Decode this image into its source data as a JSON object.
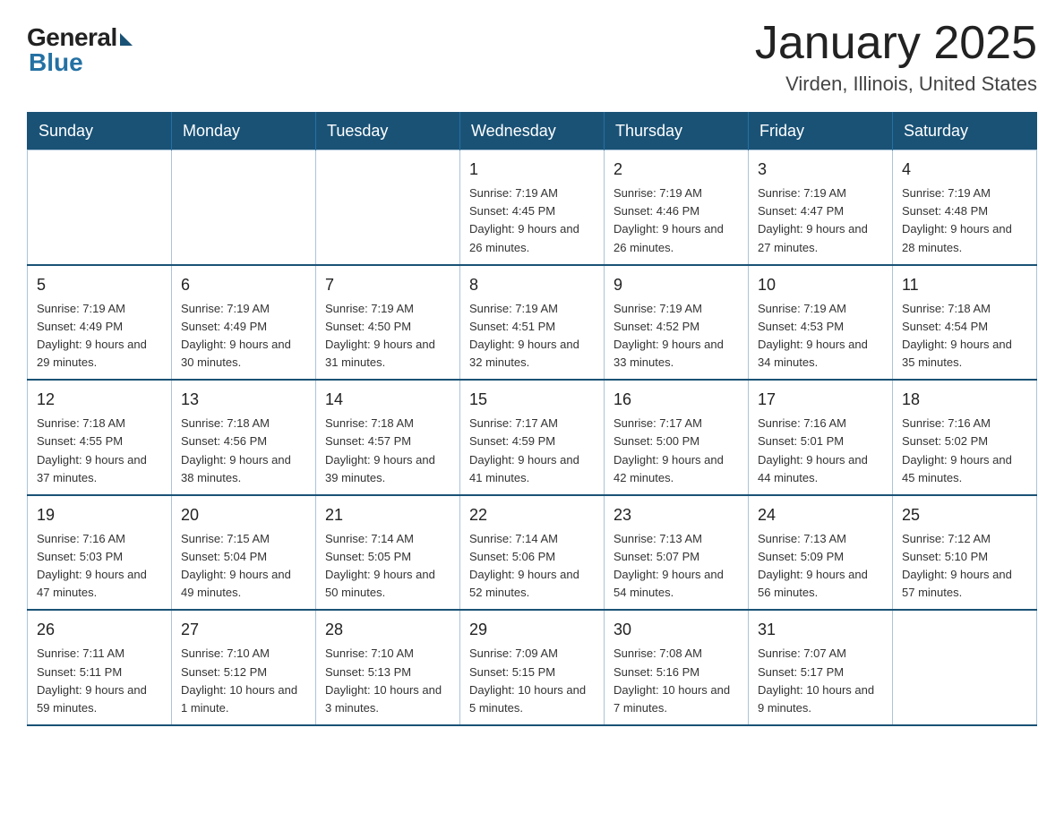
{
  "logo": {
    "general": "General",
    "blue": "Blue"
  },
  "title": "January 2025",
  "location": "Virden, Illinois, United States",
  "days": [
    "Sunday",
    "Monday",
    "Tuesday",
    "Wednesday",
    "Thursday",
    "Friday",
    "Saturday"
  ],
  "weeks": [
    [
      {
        "day": "",
        "info": ""
      },
      {
        "day": "",
        "info": ""
      },
      {
        "day": "",
        "info": ""
      },
      {
        "day": "1",
        "info": "Sunrise: 7:19 AM\nSunset: 4:45 PM\nDaylight: 9 hours\nand 26 minutes."
      },
      {
        "day": "2",
        "info": "Sunrise: 7:19 AM\nSunset: 4:46 PM\nDaylight: 9 hours\nand 26 minutes."
      },
      {
        "day": "3",
        "info": "Sunrise: 7:19 AM\nSunset: 4:47 PM\nDaylight: 9 hours\nand 27 minutes."
      },
      {
        "day": "4",
        "info": "Sunrise: 7:19 AM\nSunset: 4:48 PM\nDaylight: 9 hours\nand 28 minutes."
      }
    ],
    [
      {
        "day": "5",
        "info": "Sunrise: 7:19 AM\nSunset: 4:49 PM\nDaylight: 9 hours\nand 29 minutes."
      },
      {
        "day": "6",
        "info": "Sunrise: 7:19 AM\nSunset: 4:49 PM\nDaylight: 9 hours\nand 30 minutes."
      },
      {
        "day": "7",
        "info": "Sunrise: 7:19 AM\nSunset: 4:50 PM\nDaylight: 9 hours\nand 31 minutes."
      },
      {
        "day": "8",
        "info": "Sunrise: 7:19 AM\nSunset: 4:51 PM\nDaylight: 9 hours\nand 32 minutes."
      },
      {
        "day": "9",
        "info": "Sunrise: 7:19 AM\nSunset: 4:52 PM\nDaylight: 9 hours\nand 33 minutes."
      },
      {
        "day": "10",
        "info": "Sunrise: 7:19 AM\nSunset: 4:53 PM\nDaylight: 9 hours\nand 34 minutes."
      },
      {
        "day": "11",
        "info": "Sunrise: 7:18 AM\nSunset: 4:54 PM\nDaylight: 9 hours\nand 35 minutes."
      }
    ],
    [
      {
        "day": "12",
        "info": "Sunrise: 7:18 AM\nSunset: 4:55 PM\nDaylight: 9 hours\nand 37 minutes."
      },
      {
        "day": "13",
        "info": "Sunrise: 7:18 AM\nSunset: 4:56 PM\nDaylight: 9 hours\nand 38 minutes."
      },
      {
        "day": "14",
        "info": "Sunrise: 7:18 AM\nSunset: 4:57 PM\nDaylight: 9 hours\nand 39 minutes."
      },
      {
        "day": "15",
        "info": "Sunrise: 7:17 AM\nSunset: 4:59 PM\nDaylight: 9 hours\nand 41 minutes."
      },
      {
        "day": "16",
        "info": "Sunrise: 7:17 AM\nSunset: 5:00 PM\nDaylight: 9 hours\nand 42 minutes."
      },
      {
        "day": "17",
        "info": "Sunrise: 7:16 AM\nSunset: 5:01 PM\nDaylight: 9 hours\nand 44 minutes."
      },
      {
        "day": "18",
        "info": "Sunrise: 7:16 AM\nSunset: 5:02 PM\nDaylight: 9 hours\nand 45 minutes."
      }
    ],
    [
      {
        "day": "19",
        "info": "Sunrise: 7:16 AM\nSunset: 5:03 PM\nDaylight: 9 hours\nand 47 minutes."
      },
      {
        "day": "20",
        "info": "Sunrise: 7:15 AM\nSunset: 5:04 PM\nDaylight: 9 hours\nand 49 minutes."
      },
      {
        "day": "21",
        "info": "Sunrise: 7:14 AM\nSunset: 5:05 PM\nDaylight: 9 hours\nand 50 minutes."
      },
      {
        "day": "22",
        "info": "Sunrise: 7:14 AM\nSunset: 5:06 PM\nDaylight: 9 hours\nand 52 minutes."
      },
      {
        "day": "23",
        "info": "Sunrise: 7:13 AM\nSunset: 5:07 PM\nDaylight: 9 hours\nand 54 minutes."
      },
      {
        "day": "24",
        "info": "Sunrise: 7:13 AM\nSunset: 5:09 PM\nDaylight: 9 hours\nand 56 minutes."
      },
      {
        "day": "25",
        "info": "Sunrise: 7:12 AM\nSunset: 5:10 PM\nDaylight: 9 hours\nand 57 minutes."
      }
    ],
    [
      {
        "day": "26",
        "info": "Sunrise: 7:11 AM\nSunset: 5:11 PM\nDaylight: 9 hours\nand 59 minutes."
      },
      {
        "day": "27",
        "info": "Sunrise: 7:10 AM\nSunset: 5:12 PM\nDaylight: 10 hours\nand 1 minute."
      },
      {
        "day": "28",
        "info": "Sunrise: 7:10 AM\nSunset: 5:13 PM\nDaylight: 10 hours\nand 3 minutes."
      },
      {
        "day": "29",
        "info": "Sunrise: 7:09 AM\nSunset: 5:15 PM\nDaylight: 10 hours\nand 5 minutes."
      },
      {
        "day": "30",
        "info": "Sunrise: 7:08 AM\nSunset: 5:16 PM\nDaylight: 10 hours\nand 7 minutes."
      },
      {
        "day": "31",
        "info": "Sunrise: 7:07 AM\nSunset: 5:17 PM\nDaylight: 10 hours\nand 9 minutes."
      },
      {
        "day": "",
        "info": ""
      }
    ]
  ]
}
